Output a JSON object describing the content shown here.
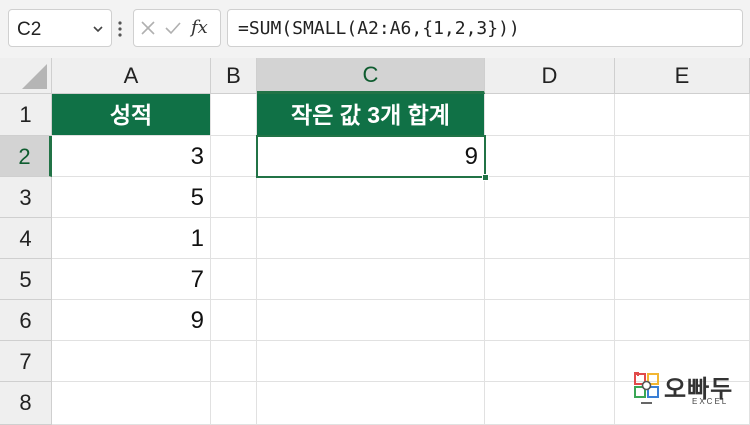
{
  "name_box": {
    "value": "C2"
  },
  "formula_bar": {
    "cancel_icon": "x-icon",
    "enter_icon": "check-icon",
    "fx_label": "fx",
    "formula": "=SUM(SMALL(A2:A6,{1,2,3}))"
  },
  "sheet": {
    "columns": [
      "A",
      "B",
      "C",
      "D",
      "E"
    ],
    "rows": [
      "1",
      "2",
      "3",
      "4",
      "5",
      "6",
      "7",
      "8"
    ],
    "selected_column": "C",
    "selected_row": "2",
    "cells": {
      "A1": "성적",
      "A2": "3",
      "A3": "5",
      "A4": "1",
      "A5": "7",
      "A6": "9",
      "C1": "작은 값 3개 합계",
      "C2": "9"
    }
  },
  "logo": {
    "text": "오빠두",
    "subtext": "EXCEL"
  },
  "colors": {
    "header_fill": "#107146",
    "selection": "#217346"
  }
}
